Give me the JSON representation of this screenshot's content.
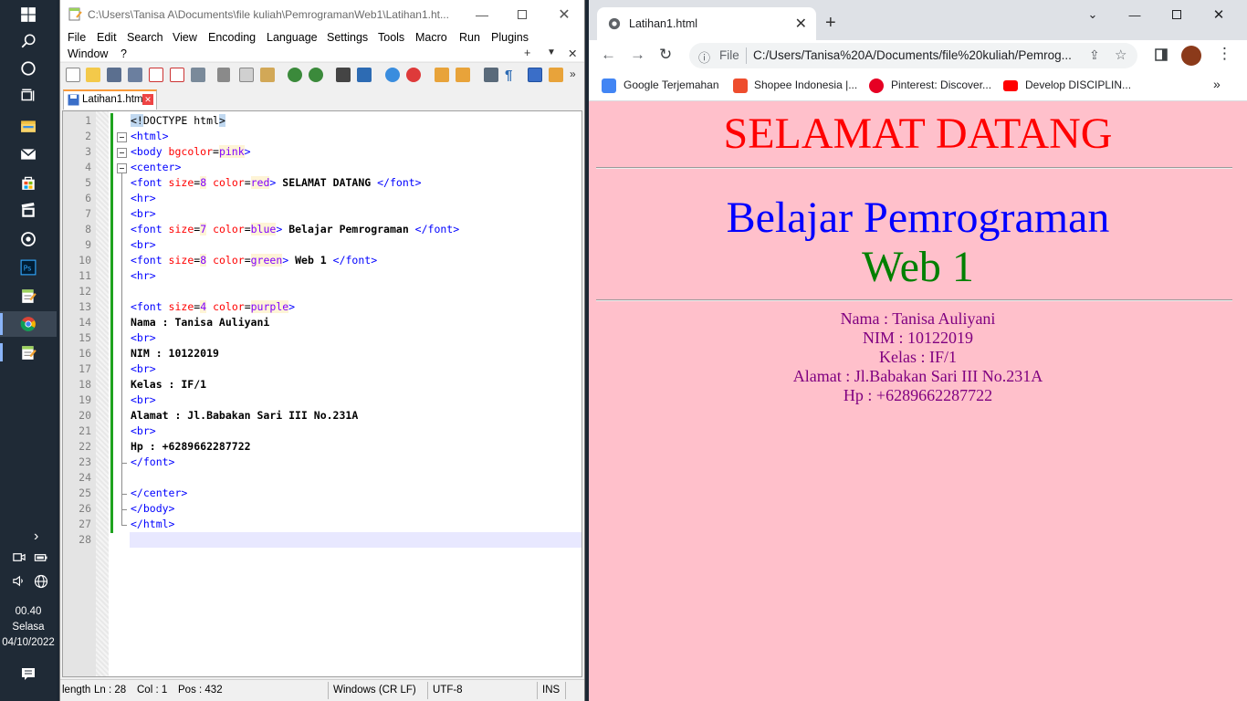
{
  "taskbar": {
    "clock_time": "00.40",
    "clock_day": "Selasa",
    "clock_date": "04/10/2022",
    "icons": [
      "windows-start-icon",
      "search-icon",
      "cortana-icon",
      "task-view-icon",
      "file-explorer-icon",
      "mail-icon",
      "store-icon",
      "film-icon",
      "media-icon",
      "photoshop-icon",
      "notepad-icon",
      "chrome-icon",
      "notepad-icon"
    ]
  },
  "npp": {
    "title": "C:\\Users\\Tanisa A\\Documents\\file kuliah\\PemrogramanWeb1\\Latihan1.ht...",
    "menu": [
      "File",
      "Edit",
      "Search",
      "View",
      "Encoding",
      "Language",
      "Settings",
      "Tools",
      "Macro",
      "Run",
      "Plugins",
      "Window",
      "?"
    ],
    "tab_label": "Latihan1.html",
    "line_numbers": [
      "1",
      "2",
      "3",
      "4",
      "5",
      "6",
      "7",
      "8",
      "9",
      "10",
      "11",
      "12",
      "13",
      "14",
      "15",
      "16",
      "17",
      "18",
      "19",
      "20",
      "21",
      "22",
      "23",
      "24",
      "25",
      "26",
      "27",
      "28"
    ],
    "status": {
      "length": "length",
      "ln": "Ln : 28",
      "col": "Col : 1",
      "pos": "Pos : 432",
      "eol": "Windows (CR LF)",
      "encoding": "UTF-8",
      "mode": "INS"
    }
  },
  "chrome": {
    "tab_title": "Latihan1.html",
    "file_label": "File",
    "url": "C:/Users/Tanisa%20A/Documents/file%20kuliah/Pemrog...",
    "bookmarks": [
      "Google Terjemahan",
      "Shopee Indonesia |...",
      "Pinterest: Discover...",
      "Develop DISCIPLIN..."
    ],
    "page": {
      "welcome": "SELAMAT DATANG",
      "belajar": "Belajar Pemrograman",
      "web": "Web 1",
      "nama": "Nama : Tanisa Auliyani",
      "nim": "NIM : 10122019",
      "kelas": "Kelas : IF/1",
      "alamat": "Alamat : Jl.Babakan Sari III No.231A",
      "hp": "Hp : +6289662287722"
    },
    "colors": {
      "page_bg": "#ffc0cb",
      "welcome": "#ff0000",
      "belajar": "#0000ff",
      "web": "#008000",
      "info": "#800080"
    }
  },
  "code_lines": [
    [
      [
        "hl",
        "<!"
      ],
      [
        "plain",
        "DOCTYPE html"
      ],
      [
        "hl",
        ">"
      ]
    ],
    [
      [
        "tag",
        "<html>"
      ]
    ],
    [
      [
        "tag",
        "<body "
      ],
      [
        "attr",
        "bgcolor"
      ],
      [
        "eq",
        "="
      ],
      [
        "val",
        "pink"
      ],
      [
        "tag",
        ">"
      ]
    ],
    [
      [
        "tag",
        "<center>"
      ]
    ],
    [
      [
        "tag",
        "<font "
      ],
      [
        "attr",
        "size"
      ],
      [
        "eq",
        "="
      ],
      [
        "val",
        "8"
      ],
      [
        "tag",
        " "
      ],
      [
        "attr",
        "color"
      ],
      [
        "eq",
        "="
      ],
      [
        "val",
        "red"
      ],
      [
        "tag",
        ">"
      ],
      [
        "text",
        " SELAMAT DATANG "
      ],
      [
        "tag",
        "</font>"
      ]
    ],
    [
      [
        "tag",
        "<hr>"
      ]
    ],
    [
      [
        "tag",
        "<br>"
      ]
    ],
    [
      [
        "tag",
        "<font "
      ],
      [
        "attr",
        "size"
      ],
      [
        "eq",
        "="
      ],
      [
        "val",
        "7"
      ],
      [
        "tag",
        " "
      ],
      [
        "attr",
        "color"
      ],
      [
        "eq",
        "="
      ],
      [
        "val",
        "blue"
      ],
      [
        "tag",
        ">"
      ],
      [
        "text",
        " Belajar Pemrograman "
      ],
      [
        "tag",
        "</font>"
      ]
    ],
    [
      [
        "tag",
        "<br>"
      ]
    ],
    [
      [
        "tag",
        "<font "
      ],
      [
        "attr",
        "size"
      ],
      [
        "eq",
        "="
      ],
      [
        "val",
        "8"
      ],
      [
        "tag",
        " "
      ],
      [
        "attr",
        "color"
      ],
      [
        "eq",
        "="
      ],
      [
        "val",
        "green"
      ],
      [
        "tag",
        ">"
      ],
      [
        "text",
        " Web 1 "
      ],
      [
        "tag",
        "</font>"
      ]
    ],
    [
      [
        "tag",
        "<hr>"
      ]
    ],
    [],
    [
      [
        "tag",
        "<font "
      ],
      [
        "attr",
        "size"
      ],
      [
        "eq",
        "="
      ],
      [
        "val",
        "4"
      ],
      [
        "tag",
        " "
      ],
      [
        "attr",
        "color"
      ],
      [
        "eq",
        "="
      ],
      [
        "val",
        "purple"
      ],
      [
        "tag",
        ">"
      ]
    ],
    [
      [
        "text",
        "Nama : Tanisa Auliyani"
      ]
    ],
    [
      [
        "tag",
        "<br>"
      ]
    ],
    [
      [
        "text",
        "NIM : 10122019"
      ]
    ],
    [
      [
        "tag",
        "<br>"
      ]
    ],
    [
      [
        "text",
        "Kelas : IF/1"
      ]
    ],
    [
      [
        "tag",
        "<br>"
      ]
    ],
    [
      [
        "text",
        "Alamat : Jl.Babakan Sari III No.231A"
      ]
    ],
    [
      [
        "tag",
        "<br>"
      ]
    ],
    [
      [
        "text",
        "Hp : +6289662287722"
      ]
    ],
    [
      [
        "tag",
        "</font>"
      ]
    ],
    [],
    [
      [
        "tag",
        "</center>"
      ]
    ],
    [
      [
        "tag",
        "</body>"
      ]
    ],
    [
      [
        "tag",
        "</html>"
      ]
    ],
    []
  ]
}
